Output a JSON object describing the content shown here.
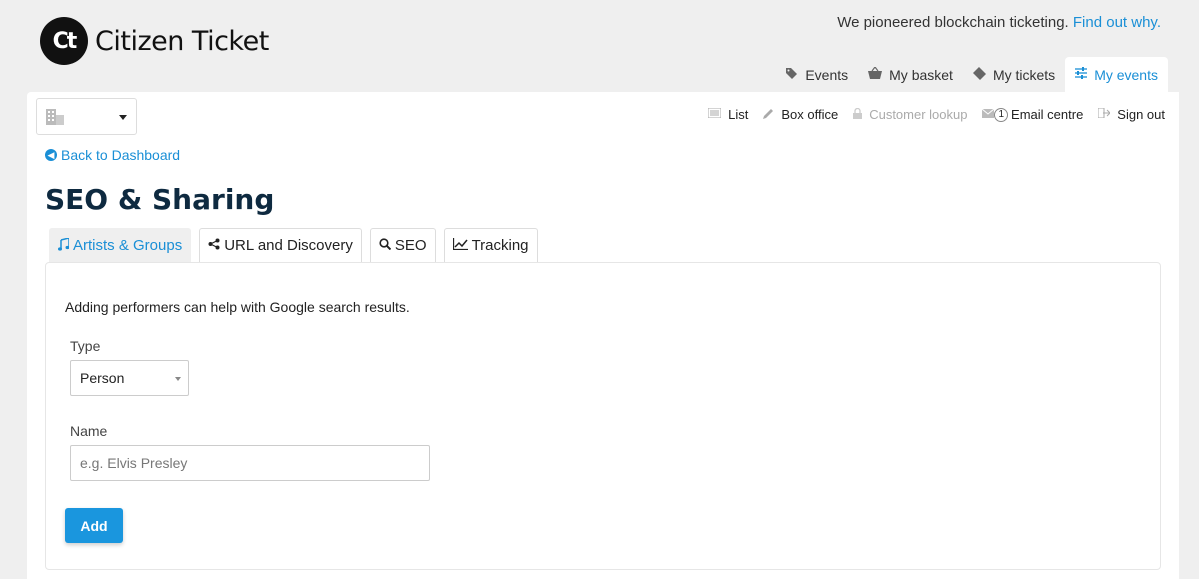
{
  "brand": {
    "logo_mark": "Ct",
    "name": "Citizen Ticket"
  },
  "tagline": {
    "text": "We pioneered blockchain ticketing. ",
    "link": "Find out why."
  },
  "main_nav": [
    {
      "label": "Events",
      "icon": "tag-icon",
      "active": false
    },
    {
      "label": "My basket",
      "icon": "basket-icon",
      "active": false
    },
    {
      "label": "My tickets",
      "icon": "ticket-icon",
      "active": false
    },
    {
      "label": "My events",
      "icon": "sliders-icon",
      "active": true
    }
  ],
  "venue_select": {
    "icon": "building-icon"
  },
  "sub_nav": [
    {
      "label": "List",
      "icon": "list-icon",
      "disabled": false
    },
    {
      "label": "Box office",
      "icon": "pencil-icon",
      "disabled": false
    },
    {
      "label": "Customer lookup",
      "icon": "lock-icon",
      "disabled": true
    },
    {
      "label": "Email centre",
      "icon": "envelope-icon",
      "badge": "1",
      "disabled": false
    },
    {
      "label": "Sign out",
      "icon": "sign-out-icon",
      "disabled": false
    }
  ],
  "back_link": "Back to Dashboard",
  "page_title": "SEO & Sharing",
  "tabs": [
    {
      "label": "Artists & Groups",
      "icon": "music-icon",
      "active": true
    },
    {
      "label": "URL and Discovery",
      "icon": "share-icon",
      "active": false
    },
    {
      "label": "SEO",
      "icon": "search-icon",
      "active": false
    },
    {
      "label": "Tracking",
      "icon": "line-chart-icon",
      "active": false
    }
  ],
  "form": {
    "intro": "Adding performers can help with Google search results.",
    "type_label": "Type",
    "type_value": "Person",
    "name_label": "Name",
    "name_placeholder": "e.g. Elvis Presley",
    "name_value": "",
    "add_label": "Add"
  },
  "colors": {
    "accent": "#1a8fd6",
    "button": "#1a96de",
    "title": "#0e2a40",
    "background": "#efefef"
  }
}
